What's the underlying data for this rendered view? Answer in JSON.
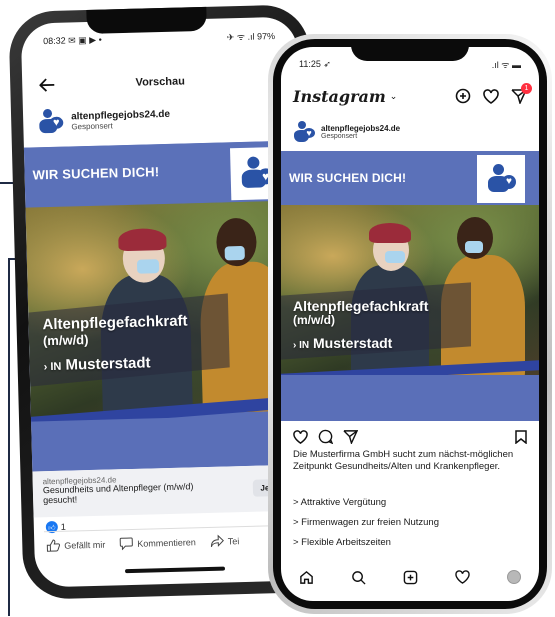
{
  "facebook": {
    "status_time": "08:32",
    "status_left_icons": "✉ ▣ ▶ •",
    "status_right": "✈ ᯤ .ıl 97%",
    "screen_title": "Vorschau",
    "page_name": "altenpflegejobs24.de",
    "sponsored": "Gesponsert",
    "ad_headline": "WIR SUCHEN DICH!",
    "job_title_line1": "Altenpflegefachkraft",
    "job_title_line2": "(m/w/d)",
    "job_loc_prefix": "› IN",
    "job_loc": "Musterstadt",
    "link_domain": "altenpflegejobs24.de",
    "link_text": "Gesundheits und Altenpfleger (m/w/d) gesucht!",
    "cta": "Jetzt bewe",
    "reactions_count": "1",
    "action_like": "Gefällt mir",
    "action_comment": "Kommentieren",
    "action_share": "Tei"
  },
  "instagram": {
    "status_time": "11:25 ➶",
    "status_right": ".ıl ᯤ ▬",
    "app_name": "Instagram",
    "notif_badge": "1",
    "page_name": "altenpflegejobs24.de",
    "sponsored": "Gesponsert",
    "ad_headline": "WIR SUCHEN DICH!",
    "job_title_line1": "Altenpflegefachkraft",
    "job_title_line2": "(m/w/d)",
    "job_loc_prefix": "› IN",
    "job_loc": "Musterstadt",
    "caption": "Die Musterfirma GmbH sucht zum nächst-möglichen Zeitpunkt Gesundheits/Alten und Krankenpfleger.",
    "bullet1": "> Attraktive Vergütung",
    "bullet2": "> Firmenwagen zur freien Nutzung",
    "bullet3": "> Flexible Arbeitszeiten"
  },
  "icons": {
    "back": "arrow-left-icon",
    "like": "thumbs-up-icon",
    "comment": "speech-bubble-icon",
    "share": "share-arrow-icon",
    "heart": "heart-icon",
    "plus": "plus-square-icon",
    "send": "paper-plane-icon",
    "bookmark": "bookmark-icon",
    "home": "home-icon",
    "search": "search-icon",
    "profile": "profile-avatar-icon"
  },
  "colors": {
    "brand_blue": "#2a53a6",
    "ad_blue": "#5b71b9",
    "stripe_blue": "#2f44a0",
    "fb_like_blue": "#1877f2"
  }
}
